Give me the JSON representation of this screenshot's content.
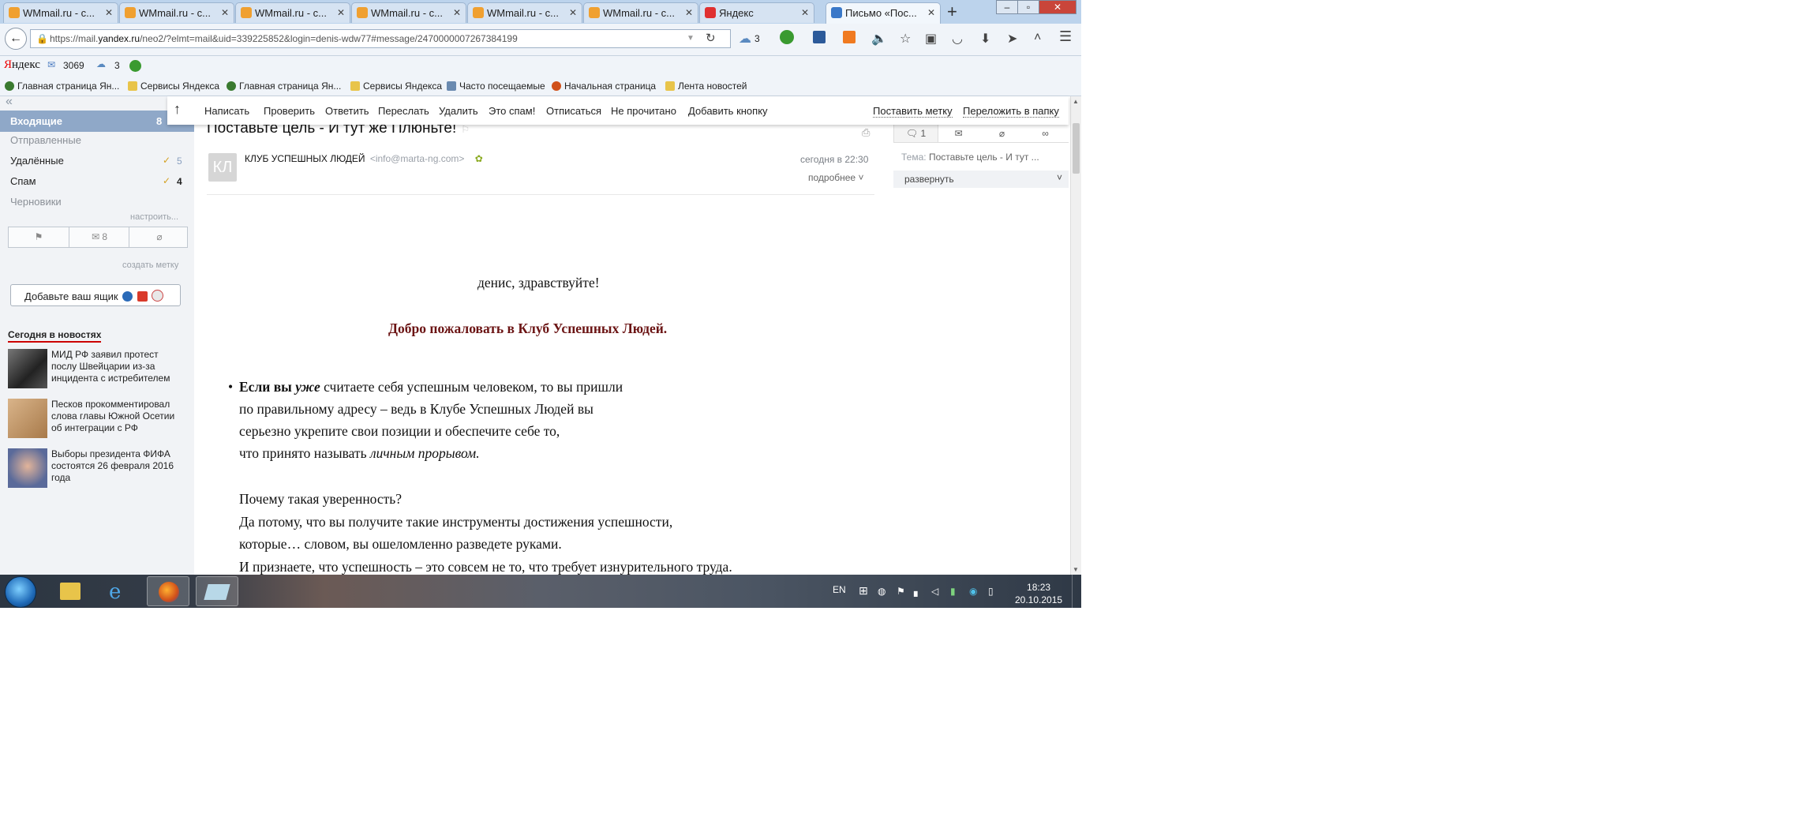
{
  "browser": {
    "tabs": [
      {
        "title": "WMmail.ru - с...",
        "icon_color": "#f0a030"
      },
      {
        "title": "WMmail.ru - с...",
        "icon_color": "#f0a030"
      },
      {
        "title": "WMmail.ru - с...",
        "icon_color": "#f0a030"
      },
      {
        "title": "WMmail.ru - с...",
        "icon_color": "#f0a030"
      },
      {
        "title": "WMmail.ru - с...",
        "icon_color": "#f0a030"
      },
      {
        "title": "WMmail.ru - с...",
        "icon_color": "#f0a030"
      },
      {
        "title": "Яндекс",
        "icon_color": "#e03030"
      },
      {
        "title": "Письмо «Пос...",
        "icon_color": "#3a78c8"
      }
    ],
    "url_prefix": "https://mail.",
    "url_host": "yandex.ru",
    "url_rest": "/neo2/?elmt=mail&uid=339225852&login=denis-wdw77#message/2470000007267384199",
    "weather_count": "3"
  },
  "yandex_bar": {
    "logo_y": "Я",
    "logo_rest": "ндекс",
    "mail_count": "3069",
    "weather_count": "3"
  },
  "bookmarks": [
    {
      "label": "Главная страница Ян...",
      "icon": "yandex-icon",
      "color": "#3a7a30"
    },
    {
      "label": "Сервисы Яндекса",
      "icon": "folder-icon",
      "color": "#e8c44a"
    },
    {
      "label": "Главная страница Ян...",
      "icon": "yandex-icon",
      "color": "#3a7a30"
    },
    {
      "label": "Сервисы Яндекса",
      "icon": "folder-icon",
      "color": "#e8c44a"
    },
    {
      "label": "Часто посещаемые",
      "icon": "page-icon",
      "color": "#6a8ab0"
    },
    {
      "label": "Начальная страница",
      "icon": "firefox-icon",
      "color": "#d0501a"
    },
    {
      "label": "Лента новостей",
      "icon": "rss-icon",
      "color": "#e8c44a"
    }
  ],
  "sidebar": {
    "collapse_glyph": "«",
    "inbox_label": "Входящие",
    "inbox_count": "8",
    "sent_label": "Отправленные",
    "trash_label": "Удалённые",
    "trash_count": "5",
    "spam_label": "Спам",
    "spam_count": "4",
    "drafts_label": "Черновики",
    "settings_link": "настроить...",
    "mail_filter_count": "8",
    "create_label_link": "создать метку",
    "add_mailbox_label": "Добавьте ваш ящик"
  },
  "news": {
    "heading": "Сегодня в новостях",
    "items": [
      {
        "text": "МИД РФ заявил протест послу Швейцарии из-за инцидента с истребителем"
      },
      {
        "text": "Песков прокомментировал слова главы Южной Осетии об интеграции с РФ"
      },
      {
        "text": "Выборы президента ФИФА состоятся 26 февраля 2016 года"
      }
    ]
  },
  "toolbar": {
    "up_glyph": "↑",
    "actions": [
      "Написать",
      "Проверить",
      "Ответить",
      "Переслать",
      "Удалить",
      "Это спам!",
      "Отписаться",
      "Не прочитано",
      "Добавить кнопку"
    ],
    "set_label": "Поставить метку",
    "move_to_folder": "Переложить в папку"
  },
  "message": {
    "subject": "Поставьте цель - И тут же Плюньте!",
    "avatar_initials": "КЛ",
    "sender_name": "КЛУБ УСПЕШНЫХ ЛЮДЕЙ",
    "sender_email": "<info@marta-ng.com>",
    "date": "сегодня в 22:30",
    "details_link": "подробнее",
    "greeting": "денис, здравствуйте!",
    "welcome": "Добро пожаловать в Клуб Успешных Людей.",
    "p1_bold": "Если вы",
    "p1_bold_italic": "уже",
    "p1_rest": "считаете себя успешным человеком, то вы пришли",
    "p1_l2": "по правильному адресу – ведь в Клубе Успешных Людей вы",
    "p1_l3": "серьезно укрепите свои позиции и обеспечите себе то,",
    "p1_l4": "что принято называть",
    "p1_l4_italic": "личным прорывом.",
    "p2_l1": "Почему такая уверенность?",
    "p2_l2": "Да потому, что вы получите такие инструменты достижения успешности,",
    "p2_l3": "которые… словом, вы ошеломленно разведете руками.",
    "p2_l4": "И признаете, что успешность – это совсем не то, что требует изнурительного труда."
  },
  "right_panel": {
    "thread_count": "1",
    "topic_label": "Тема:",
    "topic_value": "Поставьте цель - И тут ...",
    "expand_label": "развернуть"
  },
  "taskbar": {
    "lang": "EN",
    "time": "18:23",
    "date": "20.10.2015"
  }
}
